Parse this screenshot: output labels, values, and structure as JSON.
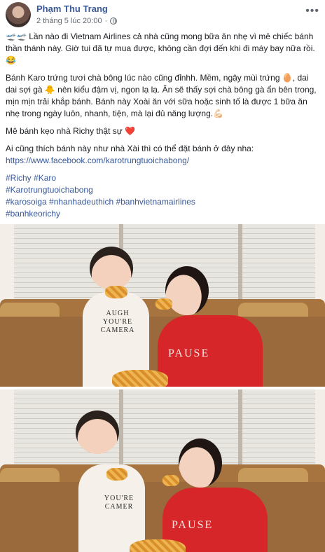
{
  "author": {
    "name": "Phạm Thu Trang",
    "timestamp": "2 tháng 5 lúc 20:00"
  },
  "icons": {
    "audience": "globe-icon",
    "more": "more-options-icon"
  },
  "paragraphs": [
    "🛫🛫 Lần nào đi Vietnam Airlines cả nhà cũng mong bữa ăn nhẹ vì mê chiếc bánh thần thánh này. Giờ tui đã tự mua được, không cần đợi đến khi đi máy bay nữa rồi.😂",
    "Bánh Karo trứng tươi chà bông lúc nào cũng đỉnhh. Mềm, ngậy mùi trứng 🥚, dai dai sợi gà 🐥 nên kiểu đậm vị, ngon lạ lạ. Ăn sẽ thấy sợi chà bông gà ẩn bên trong, mịn mịn trải khắp bánh. Bánh này Xoài ăn với sữa hoặc sinh tố là được 1 bữa ăn nhẹ trong ngày luôn, nhanh, tiện, mà lại đủ năng lượng.💪🏻",
    "Mê bánh kẹo nhà Richy thật sự ❤️"
  ],
  "order_text": "Ai cũng thích bánh này như nhà Xài thì có thể đặt bánh ở đây nha:",
  "order_link": "https://www.facebook.com/karotrungtuoichabong/",
  "hashtags": [
    "#Richy #Karo",
    "#Karotrungtuoichabong",
    "#karosoiga #nhanhadeuthich #banhvietnamairlines",
    "#banhkeorichy"
  ],
  "photos": [
    {
      "shirt_text": "AUGH\nYOU'RE\nCAMERA",
      "woman_shirt_text": "PAUSE"
    },
    {
      "shirt_text": "YOU'RE\nCAMER",
      "woman_shirt_text": "PAUSE"
    }
  ]
}
